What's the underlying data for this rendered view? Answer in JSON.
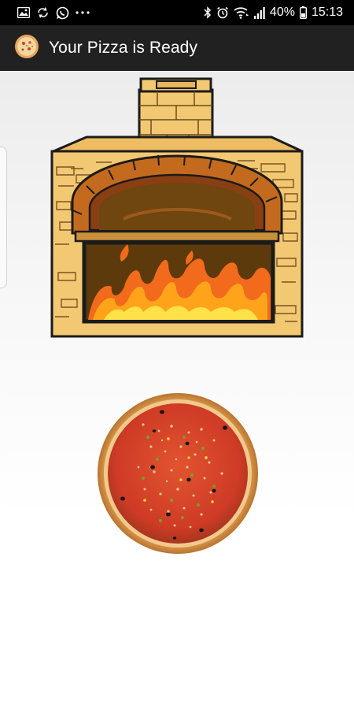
{
  "status_bar": {
    "left_icons": [
      "gallery-icon",
      "sync-icon",
      "whatsapp-icon",
      "more-icon"
    ],
    "right_icons": [
      "bluetooth-icon",
      "alarm-icon",
      "wifi-icon",
      "signal-icon",
      "battery-icon"
    ],
    "battery": "40%",
    "time": "15:13"
  },
  "app_bar": {
    "icon": "pizza-app-icon",
    "title": "Your Pizza is Ready"
  },
  "main": {
    "oven_image": "brick-oven-with-fire-illustration",
    "pizza_image": "pizza-illustration"
  },
  "colors": {
    "status_bar": "#000000",
    "app_bar": "#212121",
    "brick": "#F3C872",
    "arch": "#C46A1E",
    "fire": "#F26A1B",
    "sauce": "#D8412B",
    "crust": "#E8A960"
  }
}
